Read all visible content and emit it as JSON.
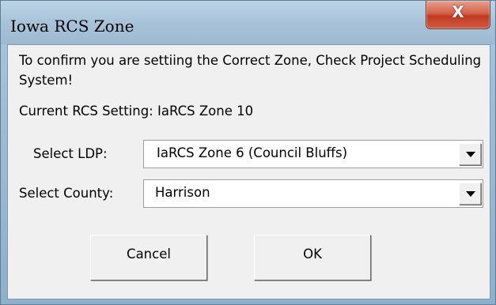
{
  "window": {
    "title": "Iowa RCS Zone",
    "close_label": "X"
  },
  "dialog": {
    "message": "To confirm you are settiing the Correct Zone, Check Project Scheduling System!",
    "current_setting": "Current RCS Setting: IaRCS Zone 10"
  },
  "ldp": {
    "label": "Select LDP:",
    "selected": "IaRCS Zone 6 (Council Bluffs)"
  },
  "county": {
    "label": "Select County:",
    "selected": "Harrison"
  },
  "buttons": {
    "cancel": "Cancel",
    "ok": "OK"
  },
  "colors": {
    "title_bar": "#a8c3d9",
    "close_button": "#c23a22",
    "dialog_background": "#f0f0f0"
  }
}
